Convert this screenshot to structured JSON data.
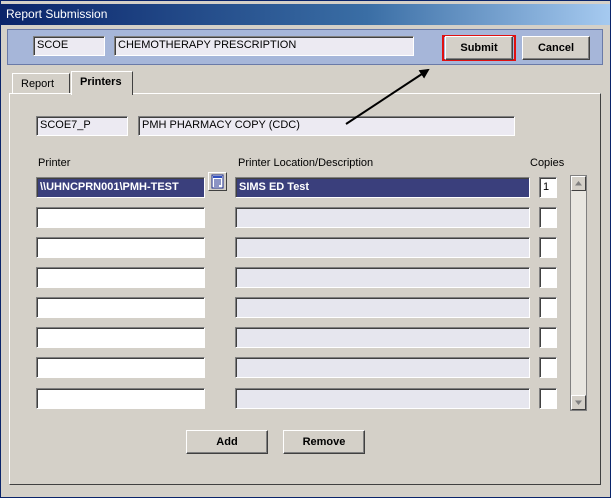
{
  "window": {
    "title": "Report Submission"
  },
  "header": {
    "report_code": "SCOE",
    "report_name": "CHEMOTHERAPY PRESCRIPTION",
    "submit_label": "Submit",
    "cancel_label": "Cancel"
  },
  "tabs": [
    {
      "label": "Report",
      "active": false
    },
    {
      "label": "Printers",
      "active": true
    }
  ],
  "printers_tab": {
    "printer_code": "SCOE7_P",
    "printer_code_desc": "PMH PHARMACY COPY (CDC)",
    "columns": {
      "printer": "Printer",
      "location": "Printer Location/Description",
      "copies": "Copies"
    },
    "rows": [
      {
        "printer": "\\\\UHNCPRN001\\PMH-TEST",
        "location": "SIMS ED Test",
        "copies": "1",
        "selected": true
      },
      {
        "printer": "",
        "location": "",
        "copies": ""
      },
      {
        "printer": "",
        "location": "",
        "copies": ""
      },
      {
        "printer": "",
        "location": "",
        "copies": ""
      },
      {
        "printer": "",
        "location": "",
        "copies": ""
      },
      {
        "printer": "",
        "location": "",
        "copies": ""
      },
      {
        "printer": "",
        "location": "",
        "copies": ""
      },
      {
        "printer": "",
        "location": "",
        "copies": ""
      }
    ],
    "add_label": "Add",
    "remove_label": "Remove"
  },
  "icons": {
    "lookup": "document-list-icon",
    "scroll_up": "scroll-up-arrow-icon",
    "scroll_down": "scroll-down-arrow-icon",
    "annotation": "annotation-arrow"
  },
  "colors": {
    "title_gradient_start": "#0a246a",
    "header_band": "#a6b6d9",
    "selected_row": "#3a3f7c",
    "highlight_outline": "#e01010"
  }
}
